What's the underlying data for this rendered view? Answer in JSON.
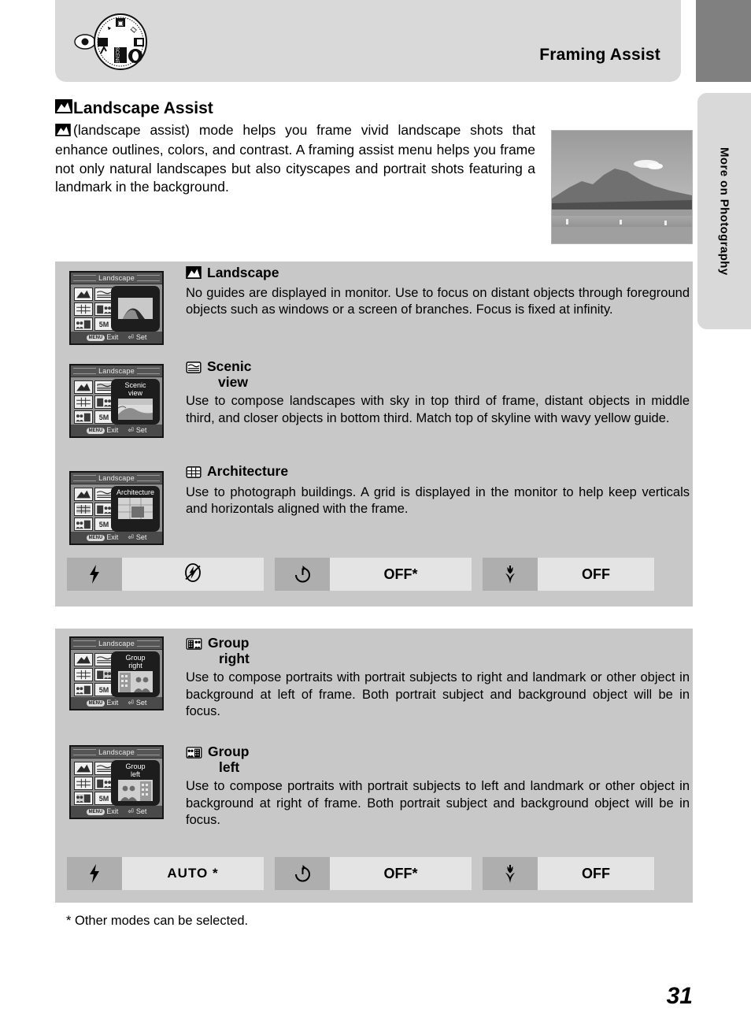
{
  "header": {
    "title": "Framing Assist",
    "mode_dial_icon": "camera-mode-dial-icon"
  },
  "side_tab": {
    "label": "More on Photography"
  },
  "intro": {
    "heading": "Landscape Assist",
    "heading_icon": "landscape-mode-icon",
    "body": "(landscape assist) mode helps you frame vivid landscape shots that enhance outlines, colors, and contrast. A framing assist menu helps you frame not only natural landscapes but also cityscapes and portrait shots featuring a landmark in the background.",
    "photo_alt": "landscape-sample-photo"
  },
  "lcd": {
    "title": "Landscape",
    "exit_label": "Exit",
    "set_label": "Set",
    "menu_button_label": "MENU"
  },
  "sections": [
    {
      "id": "landscape",
      "icon": "landscape-mode-icon",
      "title": "Landscape",
      "title_line2": "",
      "body": "No guides are displayed in monitor. Use to focus on distant objects through foreground objects such as windows or a screen of branches. Focus is fixed at infinity.",
      "selected_cell": 0,
      "preview_label": ""
    },
    {
      "id": "scenic-view",
      "icon": "scenic-view-icon",
      "title": "Scenic",
      "title_line2": "view",
      "body": "Use to compose landscapes with sky in top third of frame, distant objects in middle third, and closer objects in bottom third. Match top of skyline with wavy yellow guide.",
      "selected_cell": 1,
      "preview_label": "Scenic\nview"
    },
    {
      "id": "architecture",
      "icon": "architecture-grid-icon",
      "title": "Architecture",
      "title_line2": "",
      "body": "Use to photograph buildings. A grid is displayed in the monitor to help keep verticals and horizontals aligned with the frame.",
      "selected_cell": 2,
      "preview_label": "Architecture"
    },
    {
      "id": "group-right",
      "icon": "group-right-icon",
      "title": "Group",
      "title_line2": "right",
      "body": "Use to compose portraits with portrait subjects to right and landmark or other object in background at left of frame. Both portrait subject and background object will be in focus.",
      "selected_cell": 3,
      "preview_label": "Group\nright"
    },
    {
      "id": "group-left",
      "icon": "group-left-icon",
      "title": "Group",
      "title_line2": "left",
      "body": "Use to compose portraits with portrait subjects to left and landmark or other object in background at right of frame. Both portrait subject and background object will be in focus.",
      "selected_cell": 4,
      "preview_label": "Group\nleft"
    }
  ],
  "settings_bars": [
    {
      "id": "settings-bar-landscape",
      "flash": {
        "icon": "flash-icon",
        "value": "",
        "value_icon": "flash-off-icon"
      },
      "self_timer": {
        "icon": "self-timer-icon",
        "value": "OFF*"
      },
      "macro": {
        "icon": "macro-flower-icon",
        "value": "OFF"
      }
    },
    {
      "id": "settings-bar-group",
      "flash": {
        "icon": "flash-icon",
        "value": "AUTO *",
        "value_icon": ""
      },
      "self_timer": {
        "icon": "self-timer-icon",
        "value": "OFF*"
      },
      "macro": {
        "icon": "macro-flower-icon",
        "value": "OFF"
      }
    }
  ],
  "footnote": "* Other modes can be selected.",
  "page_number": "31",
  "size_cell_label": "5M",
  "colors": {
    "panel_bg": "#c8c8c8",
    "header_bg": "#d9d9d9",
    "setting_icon_bg": "#aeaeae",
    "setting_value_bg": "#e4e4e4",
    "lcd_bg": "#8f8f8f"
  }
}
